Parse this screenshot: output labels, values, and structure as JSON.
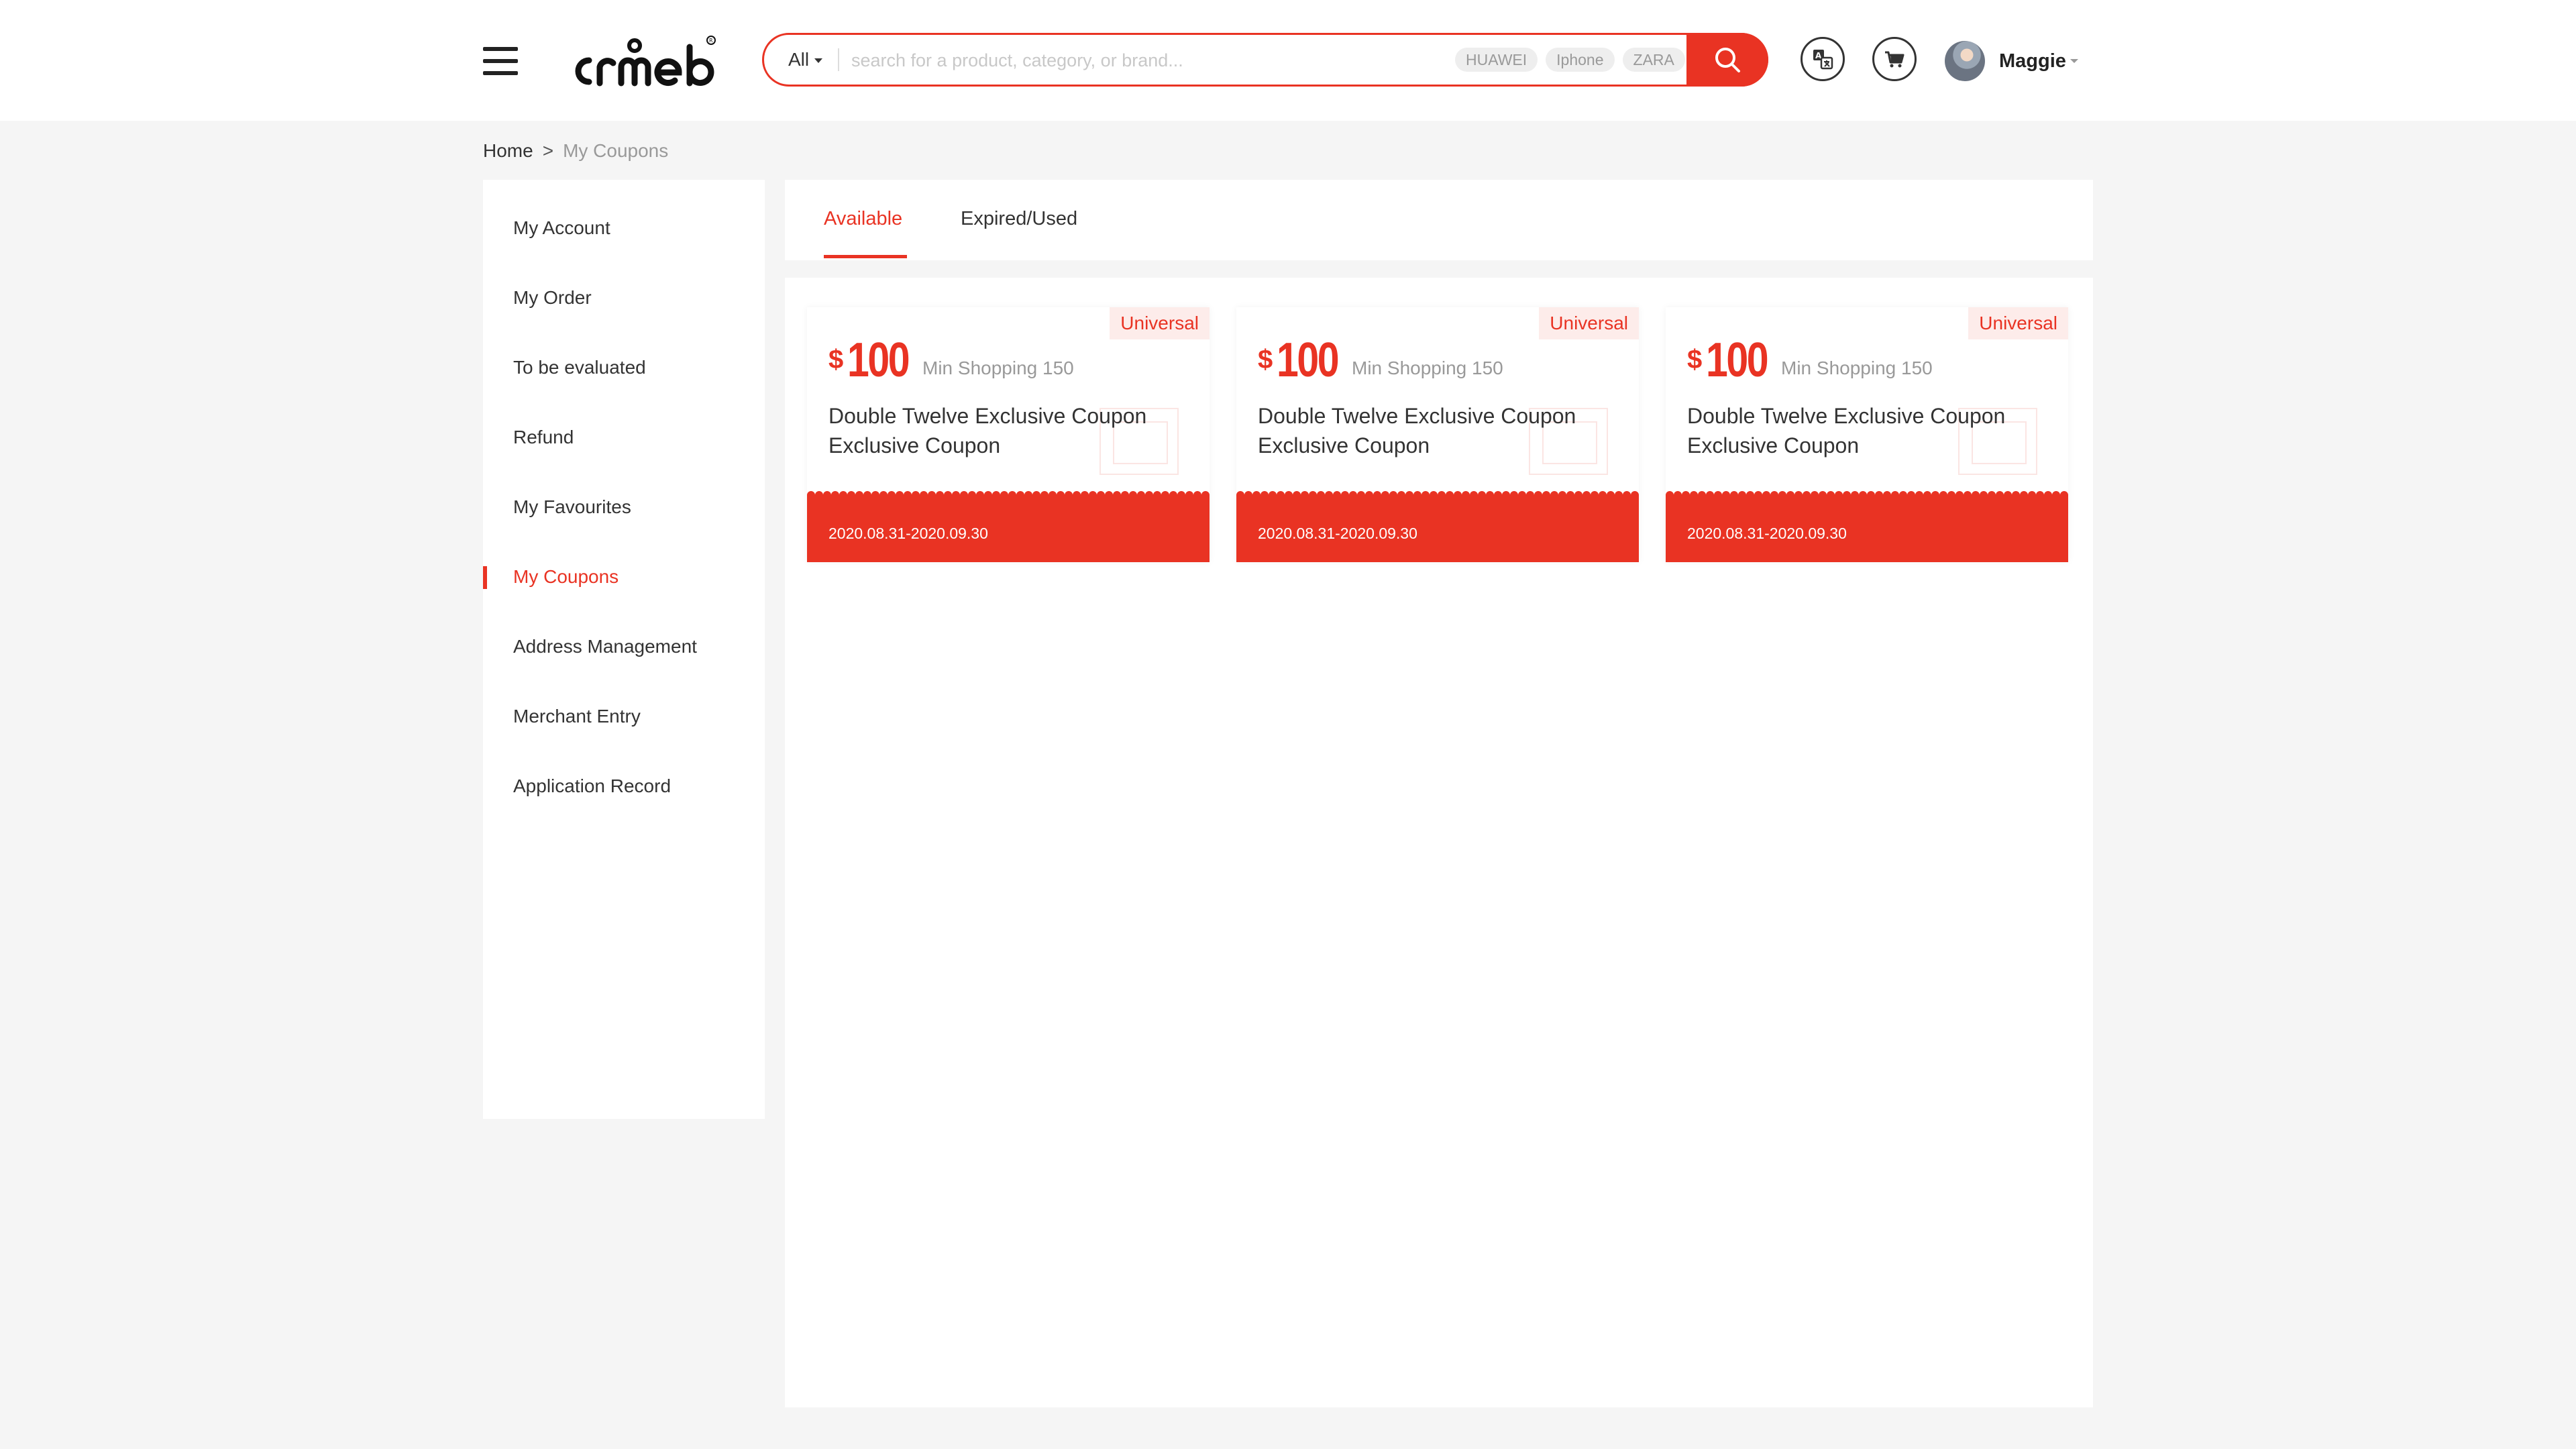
{
  "colors": {
    "accent": "#e93323",
    "background": "#f5f5f5",
    "badge_bg": "#fdecea"
  },
  "header": {
    "logo_icon": "crmeb-logo-icon",
    "menu_icon": "hamburger-menu-icon",
    "search": {
      "scope": "All",
      "placeholder": "search for a product, category, or brand...",
      "hot_tags": [
        "HUAWEI",
        "Iphone",
        "ZARA"
      ],
      "button_icon": "search-icon"
    },
    "translate_icon": "translate-icon",
    "cart_icon": "cart-icon",
    "user": {
      "name": "Maggie"
    }
  },
  "breadcrumb": {
    "home": "Home",
    "separator": ">",
    "current": "My Coupons"
  },
  "sidebar": {
    "items": [
      {
        "label": "My Account"
      },
      {
        "label": "My Order"
      },
      {
        "label": "To be evaluated"
      },
      {
        "label": "Refund"
      },
      {
        "label": "My Favourites"
      },
      {
        "label": "My Coupons",
        "active": true
      },
      {
        "label": "Address Management"
      },
      {
        "label": "Merchant Entry"
      },
      {
        "label": "Application Record"
      }
    ]
  },
  "tabs": {
    "available": "Available",
    "expired": "Expired/Used"
  },
  "coupons": [
    {
      "badge": "Universal",
      "currency": "$",
      "amount": "100",
      "min": "Min Shopping 150",
      "title": "Double Twelve Exclusive Coupon Exclusive Coupon",
      "validity": "2020.08.31-2020.09.30"
    },
    {
      "badge": "Universal",
      "currency": "$",
      "amount": "100",
      "min": "Min Shopping 150",
      "title": "Double Twelve Exclusive Coupon Exclusive Coupon",
      "validity": "2020.08.31-2020.09.30"
    },
    {
      "badge": "Universal",
      "currency": "$",
      "amount": "100",
      "min": "Min Shopping 150",
      "title": "Double Twelve Exclusive Coupon Exclusive Coupon",
      "validity": "2020.08.31-2020.09.30"
    }
  ]
}
